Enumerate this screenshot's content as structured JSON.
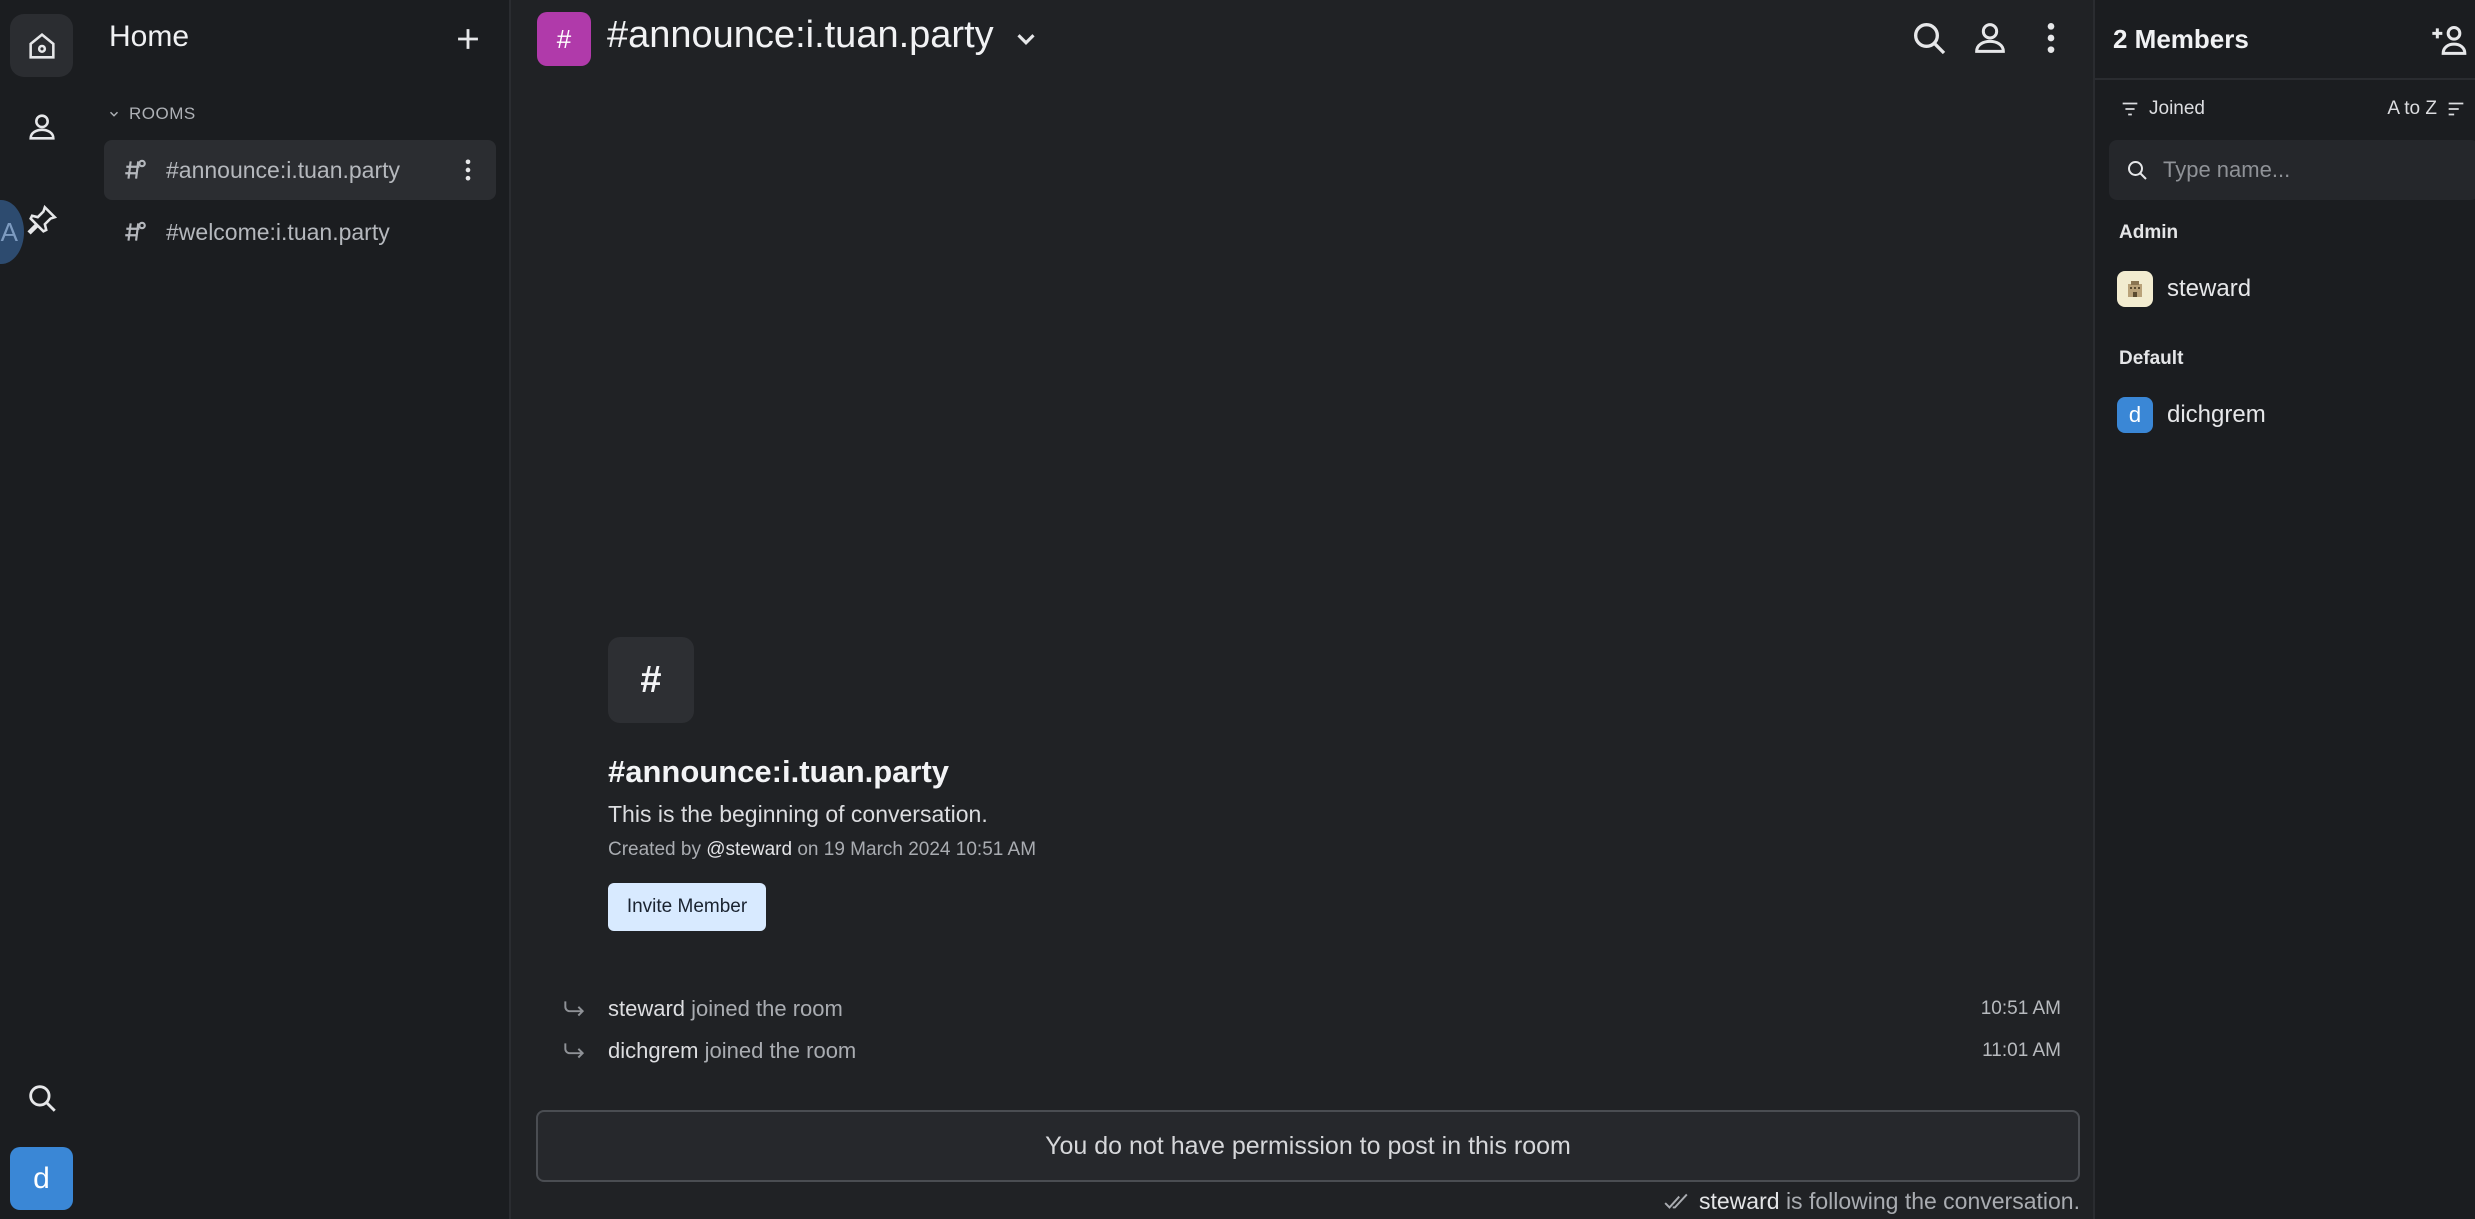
{
  "rail": {
    "user_initial": "d",
    "partial_avatar_letter": "A"
  },
  "sidebar": {
    "title": "Home",
    "section_label": "ROOMS",
    "rooms": [
      {
        "name": "#announce:i.tuan.party"
      },
      {
        "name": "#welcome:i.tuan.party"
      }
    ]
  },
  "header": {
    "room_avatar": "#",
    "room_title": "#announce:i.tuan.party"
  },
  "intro": {
    "avatar": "#",
    "title": "#announce:i.tuan.party",
    "subtitle": "This is the beginning of conversation.",
    "meta_prefix": "Created by",
    "meta_user": "@steward",
    "meta_suffix": "on 19 March 2024 10:51 AM",
    "invite_label": "Invite Member"
  },
  "events": [
    {
      "user": "steward",
      "action": "joined the room",
      "time": "10:51 AM"
    },
    {
      "user": "dichgrem",
      "action": "joined the room",
      "time": "11:01 AM"
    }
  ],
  "composer": {
    "notice": "You do not have permission to post in this room"
  },
  "following": {
    "user": "steward",
    "text": "is following the conversation."
  },
  "members": {
    "title": "2 Members",
    "filter_label": "Joined",
    "sort_label": "A to Z",
    "search_placeholder": "Type name...",
    "groups": [
      {
        "label": "Admin",
        "members": [
          {
            "name": "steward",
            "initial": ""
          }
        ]
      },
      {
        "label": "Default",
        "members": [
          {
            "name": "dichgrem",
            "initial": "d"
          }
        ]
      }
    ]
  },
  "colors": {
    "background": "#1f2124",
    "room_avatar": "#b03aaa",
    "user_avatar": "#3a87d6",
    "invite_button": "#d8eaff"
  }
}
